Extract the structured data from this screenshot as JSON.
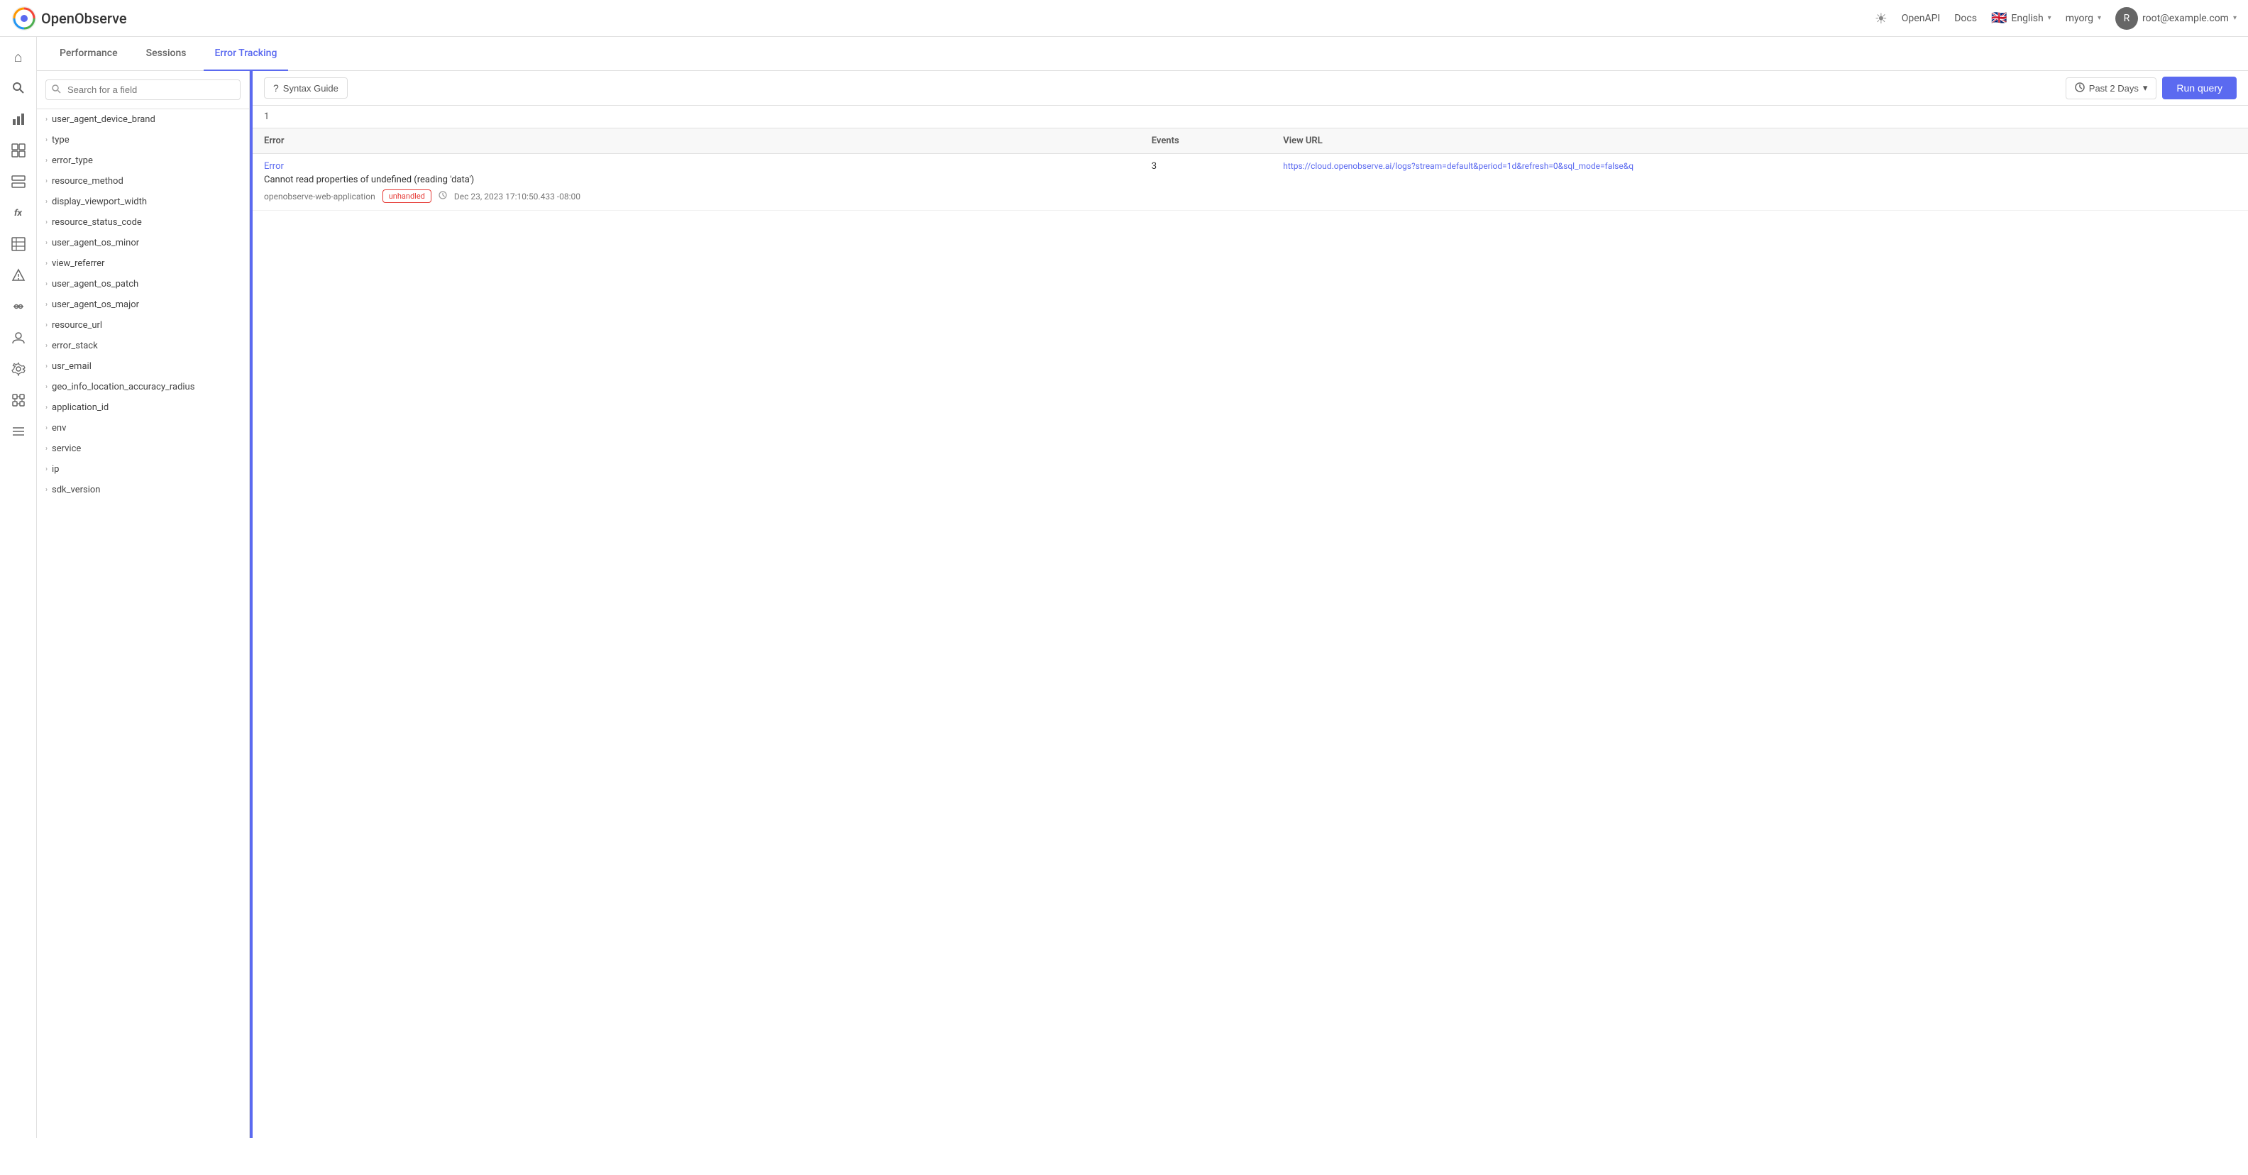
{
  "app": {
    "title": "OpenObserve"
  },
  "navbar": {
    "logo_text": "openobserve",
    "openapi_label": "OpenAPI",
    "docs_label": "Docs",
    "language": "English",
    "org": "myorg",
    "user_email": "root@example.com",
    "user_initial": "R"
  },
  "sidebar": {
    "items": [
      {
        "name": "home",
        "icon": "⌂"
      },
      {
        "name": "search",
        "icon": "🔍"
      },
      {
        "name": "metrics",
        "icon": "📊"
      },
      {
        "name": "dashboard",
        "icon": "⊞"
      },
      {
        "name": "logs",
        "icon": "▭"
      },
      {
        "name": "functions",
        "icon": "fx"
      },
      {
        "name": "table",
        "icon": "⊟"
      },
      {
        "name": "alerts",
        "icon": "△"
      },
      {
        "name": "pipeline",
        "icon": "⌥"
      },
      {
        "name": "users",
        "icon": "👤"
      },
      {
        "name": "settings",
        "icon": "⚙"
      },
      {
        "name": "integrations",
        "icon": "✦"
      },
      {
        "name": "more",
        "icon": "≡"
      }
    ]
  },
  "tabs": [
    {
      "label": "Performance",
      "active": false
    },
    {
      "label": "Sessions",
      "active": false
    },
    {
      "label": "Error Tracking",
      "active": true
    }
  ],
  "toolbar": {
    "syntax_guide_label": "Syntax Guide",
    "time_range_label": "Past 2 Days",
    "run_query_label": "Run query"
  },
  "query": {
    "line_number": "1"
  },
  "fields": {
    "search_placeholder": "Search for a field",
    "items": [
      {
        "name": "user_agent_device_brand"
      },
      {
        "name": "type"
      },
      {
        "name": "error_type"
      },
      {
        "name": "resource_method"
      },
      {
        "name": "display_viewport_width"
      },
      {
        "name": "resource_status_code"
      },
      {
        "name": "user_agent_os_minor"
      },
      {
        "name": "view_referrer"
      },
      {
        "name": "user_agent_os_patch"
      },
      {
        "name": "user_agent_os_major"
      },
      {
        "name": "resource_url"
      },
      {
        "name": "error_stack"
      },
      {
        "name": "usr_email"
      },
      {
        "name": "geo_info_location_accuracy_radius"
      },
      {
        "name": "application_id"
      },
      {
        "name": "env"
      },
      {
        "name": "service"
      },
      {
        "name": "ip"
      },
      {
        "name": "sdk_version"
      }
    ]
  },
  "results": {
    "columns": [
      {
        "label": "Error"
      },
      {
        "label": "Events"
      },
      {
        "label": "View URL"
      }
    ],
    "rows": [
      {
        "error_label": "Error",
        "error_message": "Cannot read properties of undefined (reading 'data')",
        "source": "openobserve-web-application",
        "badge": "unhandled",
        "timestamp": "Dec 23, 2023 17:10:50.433 -08:00",
        "events": "3",
        "view_url": "https://cloud.openobserve.ai/logs?stream=default&period=1d&refresh=0&sql_mode=false&q"
      }
    ]
  }
}
